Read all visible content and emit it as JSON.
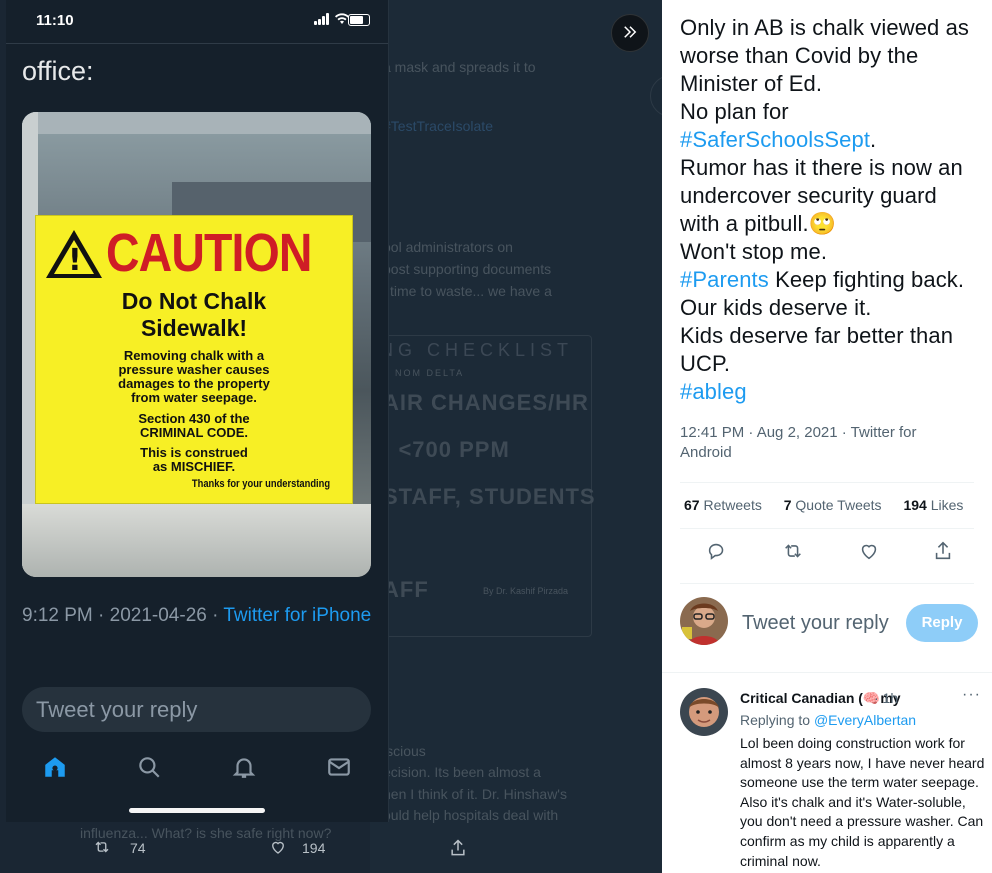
{
  "phone": {
    "status_time": "11:10",
    "caption_fragment": "office:",
    "sign": {
      "caution": "CAUTION",
      "title_line1": "Do Not Chalk",
      "title_line2": "Sidewalk!",
      "body_line1": "Removing chalk with a",
      "body_line2": "pressure washer causes",
      "body_line3": "damages to the property",
      "body_line4": "from water seepage.",
      "section_line1": "Section 430 of the",
      "section_line2": "CRIMINAL CODE.",
      "construed_line1": "This is construed",
      "construed_line2": "as MISCHIEF.",
      "thanks": "Thanks for your understanding"
    },
    "timestamp": "9:12 PM · 2021-04-26 · ",
    "source": "Twitter for iPhone",
    "reply_placeholder": "Tweet your reply",
    "nav": [
      "home-icon",
      "search-icon",
      "notifications-icon",
      "messages-icon"
    ]
  },
  "background": {
    "fragments": [
      "a mask and spreads it to",
      "#TestTraceIsolate",
      "ool administrators on",
      "post supporting documents",
      "time to waste... we have a",
      "ecision. Its been almost a",
      "hen I think of it. Dr. Hinshaw's",
      "ould help hospitals deal with",
      "influenza... What? is she safe right now?",
      "iscious"
    ],
    "checklist": "NG CHECKLIST",
    "checklist_sub": "NOM DELTA",
    "big1": "AIR CHANGES/HR",
    "big2": ": <700 PPM",
    "big3": "STAFF, STUDENTS",
    "big4": "AFF",
    "byline": "By Dr. Kashif Pirzada",
    "retweets_count": "74",
    "likes_count": "194"
  },
  "tweet": {
    "lines": [
      {
        "text": "Only in AB is chalk viewed as"
      },
      {
        "text": "worse than Covid by the"
      },
      {
        "text": "Minister of Ed."
      },
      {
        "text": "No plan for"
      },
      {
        "hashtag": "#SaferSchoolsSept",
        "text": "."
      },
      {
        "text": "Rumor has it there is now an"
      },
      {
        "text": "undercover security guard"
      },
      {
        "text": "with a pitbull.",
        "emoji": "🙄"
      },
      {
        "text": "Won't stop me."
      },
      {
        "hashtag": "#Parents",
        "text": " Keep fighting back."
      },
      {
        "text": "Our kids deserve it."
      },
      {
        "text": "Kids deserve far better than"
      },
      {
        "text": "UCP."
      },
      {
        "hashtag": "#ableg",
        "text": ""
      }
    ],
    "meta_line1": "12:41 PM · Aug 2, 2021 · Twitter for",
    "meta_line2": "Android",
    "retweets": "67",
    "retweets_label": "Retweets",
    "quote_tweets": "7",
    "quote_tweets_label": "Quote Tweets",
    "likes": "194",
    "likes_label": "Likes",
    "actions": [
      "reply-icon",
      "retweet-icon",
      "like-icon",
      "share-icon"
    ]
  },
  "compose": {
    "placeholder": "Tweet your reply",
    "button": "Reply"
  },
  "reply": {
    "name": "Critical Canadian (🧠my",
    "time": "· 1h",
    "more": "···",
    "replying_label": "Replying to ",
    "replying_to": "@EveryAlbertan",
    "body": "Lol been doing construction work for almost 8 years now, I have never heard someone use the term water seepage. Also it's chalk and it's Water-soluble, you don't need a pressure washer. Can confirm as my child is apparently a criminal now."
  },
  "colors": {
    "accent": "#1d9bf0",
    "caution_red": "#cf1d26",
    "sign_yellow": "#f7ef25",
    "reply_button": "#8ecdf8"
  }
}
